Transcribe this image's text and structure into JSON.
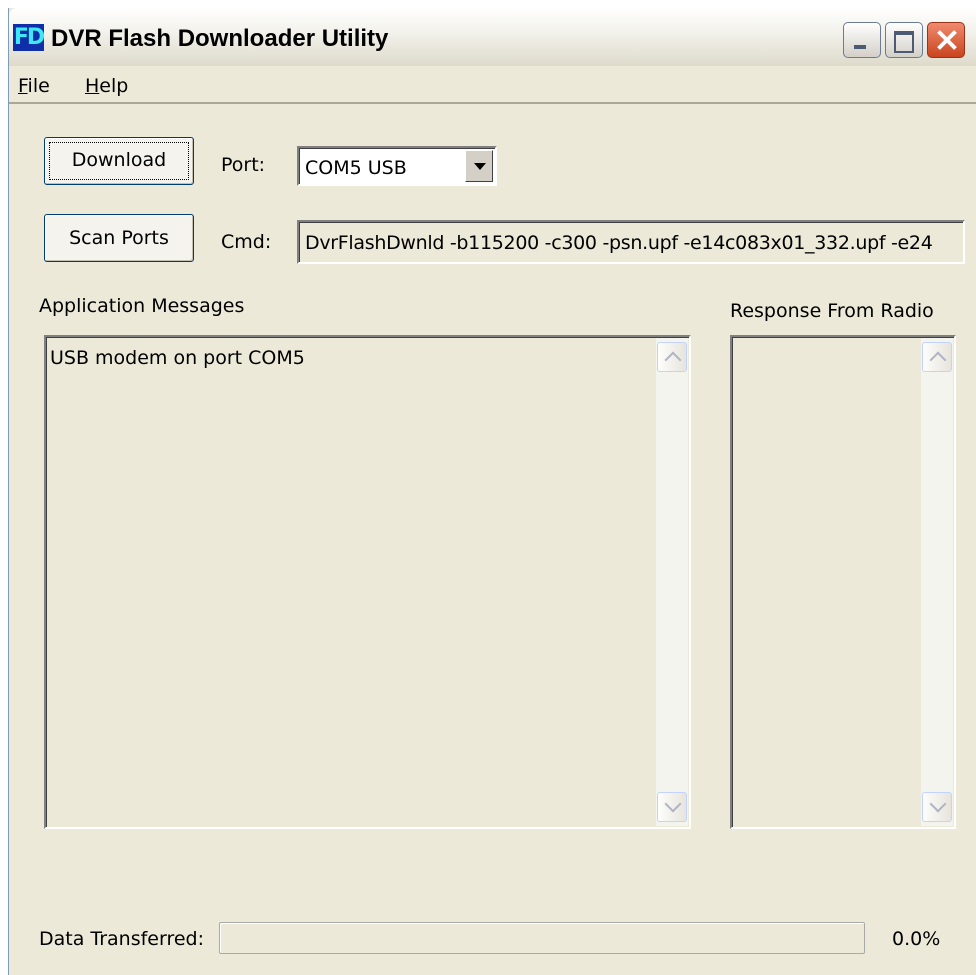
{
  "window": {
    "title": "DVR Flash Downloader Utility",
    "app_icon_text": "FD"
  },
  "menu": {
    "items": [
      "File",
      "Help"
    ]
  },
  "controls": {
    "download_label": "Download",
    "scan_ports_label": "Scan Ports",
    "port_label": "Port:",
    "port_value": "COM5 USB",
    "cmd_label": "Cmd:",
    "cmd_value": "DvrFlashDwnld -b115200 -c300 -psn.upf -e14c083x01_332.upf -e24"
  },
  "panels": {
    "app_messages_label": "Application Messages",
    "app_messages_text": "USB modem on port COM5",
    "response_label": "Response From Radio",
    "response_text": ""
  },
  "status": {
    "data_transferred_label": "Data Transferred:",
    "progress_fraction": 0.0,
    "progress_text": "0.0%"
  }
}
